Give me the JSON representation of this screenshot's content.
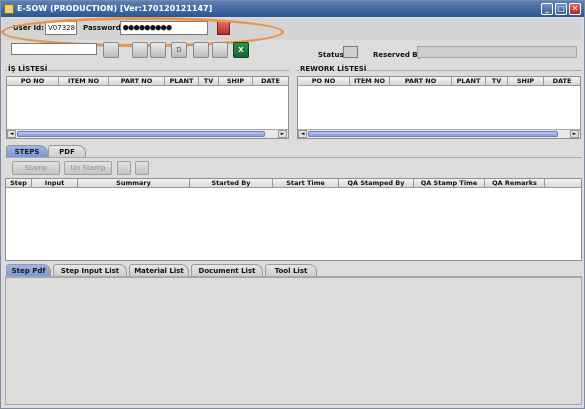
{
  "window": {
    "title": "E-SOW (PRODUCTION)  [Ver:170120121147]",
    "minimize_glyph": "_",
    "maximize_glyph": "□",
    "close_glyph": "✕"
  },
  "login": {
    "user_id_label": "User Id:",
    "user_id_value": "V07328",
    "password_label": "Password:",
    "password_value": "●●●●●●●●●"
  },
  "toolbar": {
    "d_button_label": "D",
    "status_label": "Status:",
    "reserved_by_label": "Reserved By:"
  },
  "is_listesi": {
    "title": "İŞ LİSTESİ",
    "columns": [
      "PO NO",
      "ITEM NO",
      "PART NO",
      "PLANT",
      "TV",
      "SHIP",
      "DATE"
    ]
  },
  "rework_listesi": {
    "title": "REWORK LİSTESİ",
    "columns": [
      "PO NO",
      "ITEM NO",
      "PART NO",
      "PLANT",
      "TV",
      "SHIP",
      "DATE"
    ]
  },
  "main_tabs": [
    "STEPS",
    "PDF"
  ],
  "steps": {
    "stamp_label": "Stamp",
    "unstamp_label": "Un Stamp",
    "columns": [
      "Step",
      "Input",
      "Summary",
      "Started By",
      "Start Time",
      "QA Stamped By",
      "QA Stamp Time",
      "QA Remarks"
    ]
  },
  "bottom_tabs": [
    "Step Pdf",
    "Step Input List",
    "Material List",
    "Document List",
    "Tool List"
  ],
  "colors": {
    "accent": "#7c97d6",
    "title_bar": "#2e5590",
    "highlight": "#e9944b"
  }
}
